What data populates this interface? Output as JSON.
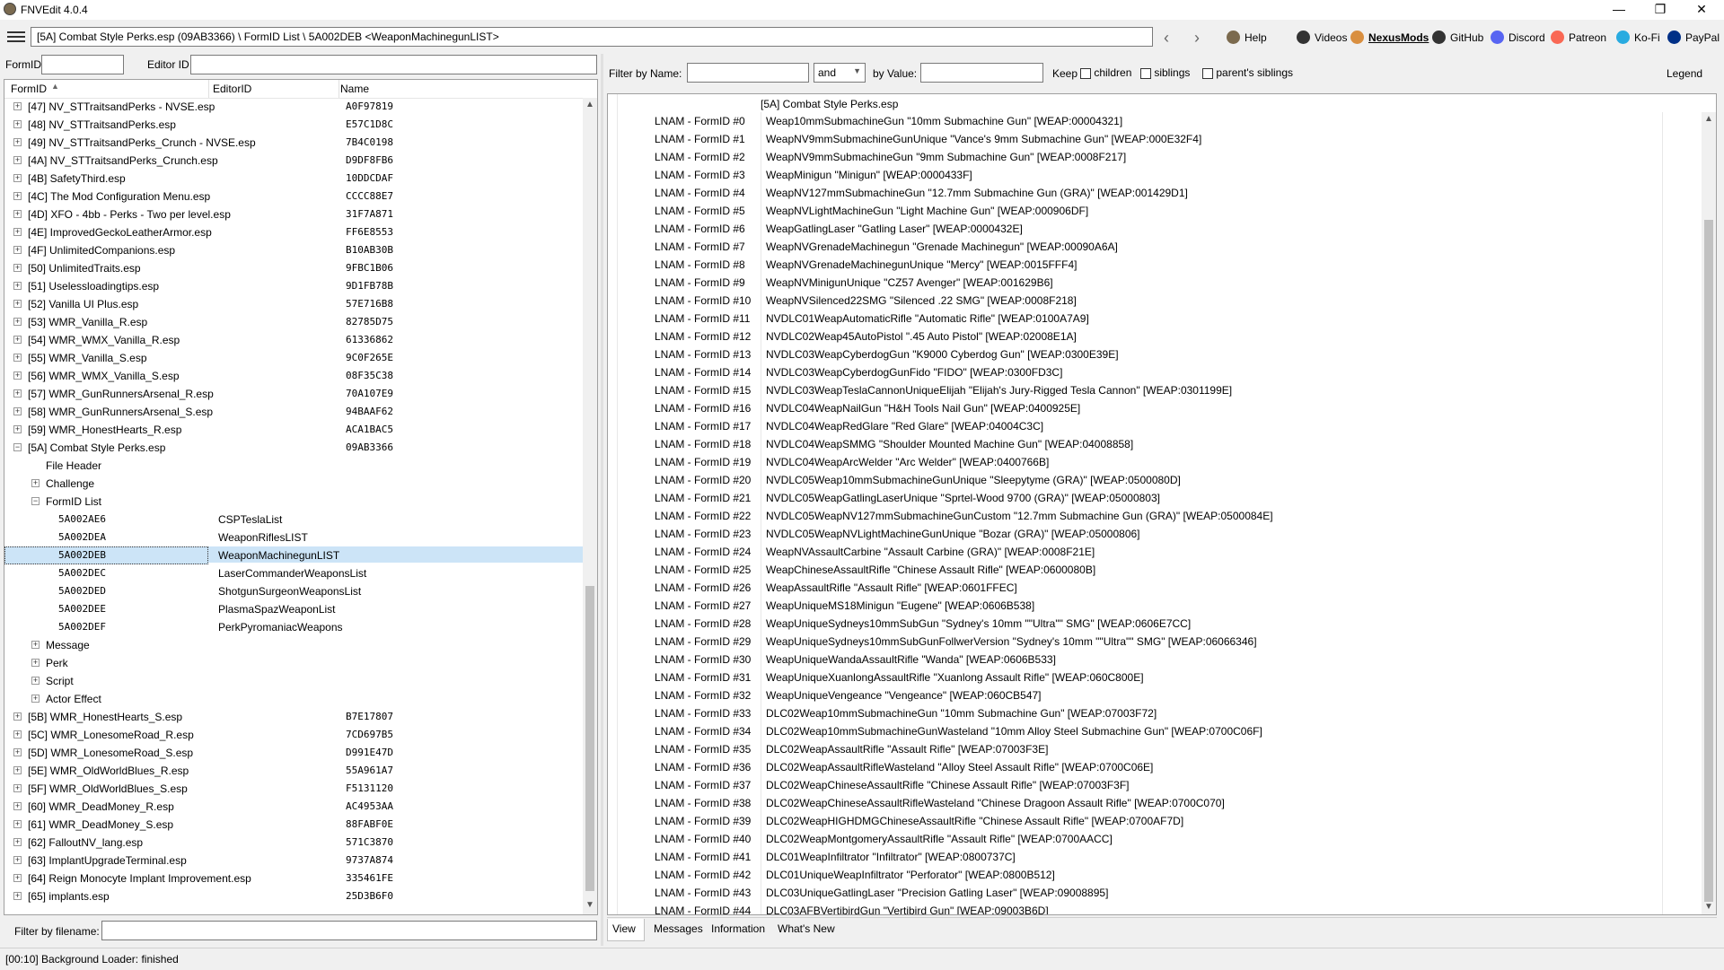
{
  "window": {
    "title": "FNVEdit 4.0.4",
    "minimize": "—",
    "maximize": "❐",
    "close": "✕"
  },
  "toolbar": {
    "path": "[5A] Combat Style Perks.esp (09AB3366) \\ FormID List \\ 5A002DEB <WeaponMachinegunLIST>",
    "links": [
      {
        "label": "Help",
        "icon": "book-icon",
        "color": "#7b6a4e"
      },
      {
        "label": "Videos",
        "icon": "video-icon",
        "color": "#333333"
      },
      {
        "label": "NexusMods",
        "icon": "nexusmods-icon",
        "color": "#d98f40"
      },
      {
        "label": "GitHub",
        "icon": "github-icon",
        "color": "#333333"
      },
      {
        "label": "Discord",
        "icon": "discord-icon",
        "color": "#5865f2"
      },
      {
        "label": "Patreon",
        "icon": "patreon-icon",
        "color": "#f96854"
      },
      {
        "label": "Ko-Fi",
        "icon": "kofi-icon",
        "color": "#29abe0"
      },
      {
        "label": "PayPal",
        "icon": "paypal-icon",
        "color": "#003087"
      }
    ]
  },
  "left_filter": {
    "formid_label": "FormID",
    "editorid_label": "Editor ID",
    "formid_value": "",
    "editorid_value": ""
  },
  "tree": {
    "columns": [
      "FormID",
      "EditorID",
      "Name"
    ],
    "rows": [
      {
        "level": 0,
        "exp": "+",
        "name": "[47] NV_STTraitsandPerks - NVSE.esp",
        "fid": "A0F97819",
        "eid": ""
      },
      {
        "level": 0,
        "exp": "+",
        "name": "[48] NV_STTraitsandPerks.esp",
        "fid": "E57C1D8C",
        "eid": ""
      },
      {
        "level": 0,
        "exp": "+",
        "name": "[49] NV_STTraitsandPerks_Crunch - NVSE.esp",
        "fid": "7B4C0198",
        "eid": ""
      },
      {
        "level": 0,
        "exp": "+",
        "name": "[4A] NV_STTraitsandPerks_Crunch.esp",
        "fid": "D9DF8FB6",
        "eid": ""
      },
      {
        "level": 0,
        "exp": "+",
        "name": "[4B] SafetyThird.esp",
        "fid": "10DDCDAF",
        "eid": ""
      },
      {
        "level": 0,
        "exp": "+",
        "name": "[4C] The Mod Configuration Menu.esp",
        "fid": "CCCC88E7",
        "eid": ""
      },
      {
        "level": 0,
        "exp": "+",
        "name": "[4D] XFO - 4bb - Perks - Two per level.esp",
        "fid": "31F7A871",
        "eid": ""
      },
      {
        "level": 0,
        "exp": "+",
        "name": "[4E] ImprovedGeckoLeatherArmor.esp",
        "fid": "FF6E8553",
        "eid": ""
      },
      {
        "level": 0,
        "exp": "+",
        "name": "[4F] UnlimitedCompanions.esp",
        "fid": "B10AB30B",
        "eid": ""
      },
      {
        "level": 0,
        "exp": "+",
        "name": "[50] UnlimitedTraits.esp",
        "fid": "9FBC1B06",
        "eid": ""
      },
      {
        "level": 0,
        "exp": "+",
        "name": "[51] Uselessloadingtips.esp",
        "fid": "9D1FB78B",
        "eid": ""
      },
      {
        "level": 0,
        "exp": "+",
        "name": "[52] Vanilla UI Plus.esp",
        "fid": "57E716B8",
        "eid": ""
      },
      {
        "level": 0,
        "exp": "+",
        "name": "[53] WMR_Vanilla_R.esp",
        "fid": "82785D75",
        "eid": ""
      },
      {
        "level": 0,
        "exp": "+",
        "name": "[54] WMR_WMX_Vanilla_R.esp",
        "fid": "61336862",
        "eid": ""
      },
      {
        "level": 0,
        "exp": "+",
        "name": "[55] WMR_Vanilla_S.esp",
        "fid": "9C0F265E",
        "eid": ""
      },
      {
        "level": 0,
        "exp": "+",
        "name": "[56] WMR_WMX_Vanilla_S.esp",
        "fid": "08F35C38",
        "eid": ""
      },
      {
        "level": 0,
        "exp": "+",
        "name": "[57] WMR_GunRunnersArsenal_R.esp",
        "fid": "70A107E9",
        "eid": ""
      },
      {
        "level": 0,
        "exp": "+",
        "name": "[58] WMR_GunRunnersArsenal_S.esp",
        "fid": "94BAAF62",
        "eid": ""
      },
      {
        "level": 0,
        "exp": "+",
        "name": "[59] WMR_HonestHearts_R.esp",
        "fid": "ACA1BAC5",
        "eid": ""
      },
      {
        "level": 0,
        "exp": "−",
        "name": "[5A] Combat Style Perks.esp",
        "fid": "09AB3366",
        "eid": ""
      },
      {
        "level": 1,
        "exp": "",
        "name": "File Header",
        "fid": "",
        "eid": ""
      },
      {
        "level": 1,
        "exp": "+",
        "name": "Challenge",
        "fid": "",
        "eid": ""
      },
      {
        "level": 1,
        "exp": "−",
        "name": "FormID List",
        "fid": "",
        "eid": ""
      },
      {
        "level": 2,
        "exp": "",
        "name": "5A002AE6",
        "fid": "",
        "eid": "CSPTeslaList"
      },
      {
        "level": 2,
        "exp": "",
        "name": "5A002DEA",
        "fid": "",
        "eid": "WeaponRiflesLIST"
      },
      {
        "level": 2,
        "exp": "",
        "name": "5A002DEB",
        "fid": "",
        "eid": "WeaponMachinegunLIST",
        "selected": true
      },
      {
        "level": 2,
        "exp": "",
        "name": "5A002DEC",
        "fid": "",
        "eid": "LaserCommanderWeaponsList"
      },
      {
        "level": 2,
        "exp": "",
        "name": "5A002DED",
        "fid": "",
        "eid": "ShotgunSurgeonWeaponsList"
      },
      {
        "level": 2,
        "exp": "",
        "name": "5A002DEE",
        "fid": "",
        "eid": "PlasmaSpazWeaponList"
      },
      {
        "level": 2,
        "exp": "",
        "name": "5A002DEF",
        "fid": "",
        "eid": "PerkPyromaniacWeapons"
      },
      {
        "level": 1,
        "exp": "+",
        "name": "Message",
        "fid": "",
        "eid": ""
      },
      {
        "level": 1,
        "exp": "+",
        "name": "Perk",
        "fid": "",
        "eid": ""
      },
      {
        "level": 1,
        "exp": "+",
        "name": "Script",
        "fid": "",
        "eid": ""
      },
      {
        "level": 1,
        "exp": "+",
        "name": "Actor Effect",
        "fid": "",
        "eid": ""
      },
      {
        "level": 0,
        "exp": "+",
        "name": "[5B] WMR_HonestHearts_S.esp",
        "fid": "B7E17807",
        "eid": ""
      },
      {
        "level": 0,
        "exp": "+",
        "name": "[5C] WMR_LonesomeRoad_R.esp",
        "fid": "7CD697B5",
        "eid": ""
      },
      {
        "level": 0,
        "exp": "+",
        "name": "[5D] WMR_LonesomeRoad_S.esp",
        "fid": "D991E47D",
        "eid": ""
      },
      {
        "level": 0,
        "exp": "+",
        "name": "[5E] WMR_OldWorldBlues_R.esp",
        "fid": "55A961A7",
        "eid": ""
      },
      {
        "level": 0,
        "exp": "+",
        "name": "[5F] WMR_OldWorldBlues_S.esp",
        "fid": "F5131120",
        "eid": ""
      },
      {
        "level": 0,
        "exp": "+",
        "name": "[60] WMR_DeadMoney_R.esp",
        "fid": "AC4953AA",
        "eid": ""
      },
      {
        "level": 0,
        "exp": "+",
        "name": "[61] WMR_DeadMoney_S.esp",
        "fid": "88FABF0E",
        "eid": ""
      },
      {
        "level": 0,
        "exp": "+",
        "name": "[62] FalloutNV_lang.esp",
        "fid": "571C3870",
        "eid": ""
      },
      {
        "level": 0,
        "exp": "+",
        "name": "[63] ImplantUpgradeTerminal.esp",
        "fid": "9737A874",
        "eid": ""
      },
      {
        "level": 0,
        "exp": "+",
        "name": "[64] Reign Monocyte Implant Improvement.esp",
        "fid": "335461FE",
        "eid": ""
      },
      {
        "level": 0,
        "exp": "+",
        "name": "[65] implants.esp",
        "fid": "25D3B6F0",
        "eid": ""
      }
    ]
  },
  "filename_filter": {
    "label": "Filter by filename:",
    "value": ""
  },
  "right_filter": {
    "name_label": "Filter by Name:",
    "and_value": "and",
    "value_label": "by Value:",
    "keep_label": "Keep",
    "children_label": "children",
    "siblings_label": "siblings",
    "parents_siblings_label": "parent's siblings",
    "legend_label": "Legend"
  },
  "view": {
    "header": "[5A] Combat Style Perks.esp",
    "rows": [
      {
        "label": "LNAM - FormID #0",
        "value": "Weap10mmSubmachineGun \"10mm Submachine Gun\" [WEAP:00004321]"
      },
      {
        "label": "LNAM - FormID #1",
        "value": "WeapNV9mmSubmachineGunUnique \"Vance's 9mm Submachine Gun\" [WEAP:000E32F4]"
      },
      {
        "label": "LNAM - FormID #2",
        "value": "WeapNV9mmSubmachineGun \"9mm Submachine Gun\" [WEAP:0008F217]"
      },
      {
        "label": "LNAM - FormID #3",
        "value": "WeapMinigun \"Minigun\" [WEAP:0000433F]"
      },
      {
        "label": "LNAM - FormID #4",
        "value": "WeapNV127mmSubmachineGun \"12.7mm Submachine Gun (GRA)\" [WEAP:001429D1]"
      },
      {
        "label": "LNAM - FormID #5",
        "value": "WeapNVLightMachineGun \"Light Machine Gun\" [WEAP:000906DF]"
      },
      {
        "label": "LNAM - FormID #6",
        "value": "WeapGatlingLaser \"Gatling Laser\" [WEAP:0000432E]"
      },
      {
        "label": "LNAM - FormID #7",
        "value": "WeapNVGrenadeMachinegun \"Grenade Machinegun\" [WEAP:00090A6A]"
      },
      {
        "label": "LNAM - FormID #8",
        "value": "WeapNVGrenadeMachinegunUnique \"Mercy\" [WEAP:0015FFF4]"
      },
      {
        "label": "LNAM - FormID #9",
        "value": "WeapNVMinigunUnique \"CZ57 Avenger\" [WEAP:001629B6]"
      },
      {
        "label": "LNAM - FormID #10",
        "value": "WeapNVSilenced22SMG \"Silenced .22 SMG\" [WEAP:0008F218]"
      },
      {
        "label": "LNAM - FormID #11",
        "value": "NVDLC01WeapAutomaticRifle \"Automatic Rifle\" [WEAP:0100A7A9]"
      },
      {
        "label": "LNAM - FormID #12",
        "value": "NVDLC02Weap45AutoPistol \".45 Auto Pistol\" [WEAP:02008E1A]"
      },
      {
        "label": "LNAM - FormID #13",
        "value": "NVDLC03WeapCyberdogGun \"K9000 Cyberdog Gun\" [WEAP:0300E39E]"
      },
      {
        "label": "LNAM - FormID #14",
        "value": "NVDLC03WeapCyberdogGunFido \"FIDO\" [WEAP:0300FD3C]"
      },
      {
        "label": "LNAM - FormID #15",
        "value": "NVDLC03WeapTeslaCannonUniqueElijah \"Elijah's Jury-Rigged Tesla Cannon\" [WEAP:0301199E]"
      },
      {
        "label": "LNAM - FormID #16",
        "value": "NVDLC04WeapNailGun \"H&H Tools Nail Gun\" [WEAP:0400925E]"
      },
      {
        "label": "LNAM - FormID #17",
        "value": "NVDLC04WeapRedGlare \"Red Glare\" [WEAP:04004C3C]"
      },
      {
        "label": "LNAM - FormID #18",
        "value": "NVDLC04WeapSMMG \"Shoulder Mounted Machine Gun\" [WEAP:04008858]"
      },
      {
        "label": "LNAM - FormID #19",
        "value": "NVDLC04WeapArcWelder \"Arc Welder\" [WEAP:0400766B]"
      },
      {
        "label": "LNAM - FormID #20",
        "value": "NVDLC05Weap10mmSubmachineGunUnique \"Sleepytyme (GRA)\" [WEAP:0500080D]"
      },
      {
        "label": "LNAM - FormID #21",
        "value": "NVDLC05WeapGatlingLaserUnique \"Sprtel-Wood 9700 (GRA)\" [WEAP:05000803]"
      },
      {
        "label": "LNAM - FormID #22",
        "value": "NVDLC05WeapNV127mmSubmachineGunCustom \"12.7mm Submachine Gun (GRA)\" [WEAP:0500084E]"
      },
      {
        "label": "LNAM - FormID #23",
        "value": "NVDLC05WeapNVLightMachineGunUnique \"Bozar (GRA)\" [WEAP:05000806]"
      },
      {
        "label": "LNAM - FormID #24",
        "value": "WeapNVAssaultCarbine \"Assault Carbine (GRA)\" [WEAP:0008F21E]"
      },
      {
        "label": "LNAM - FormID #25",
        "value": "WeapChineseAssaultRifle \"Chinese Assault Rifle\" [WEAP:0600080B]"
      },
      {
        "label": "LNAM - FormID #26",
        "value": "WeapAssaultRifle \"Assault Rifle\" [WEAP:0601FFEC]"
      },
      {
        "label": "LNAM - FormID #27",
        "value": "WeapUniqueMS18Minigun \"Eugene\" [WEAP:0606B538]"
      },
      {
        "label": "LNAM - FormID #28",
        "value": "WeapUniqueSydneys10mmSubGun \"Sydney's 10mm \"\"Ultra\"\" SMG\" [WEAP:0606E7CC]"
      },
      {
        "label": "LNAM - FormID #29",
        "value": "WeapUniqueSydneys10mmSubGunFollwerVersion \"Sydney's 10mm \"\"Ultra\"\" SMG\" [WEAP:06066346]"
      },
      {
        "label": "LNAM - FormID #30",
        "value": "WeapUniqueWandaAssaultRifle \"Wanda\" [WEAP:0606B533]"
      },
      {
        "label": "LNAM - FormID #31",
        "value": "WeapUniqueXuanlongAssaultRifle \"Xuanlong Assault Rifle\" [WEAP:060C800E]"
      },
      {
        "label": "LNAM - FormID #32",
        "value": "WeapUniqueVengeance \"Vengeance\" [WEAP:060CB547]"
      },
      {
        "label": "LNAM - FormID #33",
        "value": "DLC02Weap10mmSubmachineGun \"10mm Submachine Gun\" [WEAP:07003F72]"
      },
      {
        "label": "LNAM - FormID #34",
        "value": "DLC02Weap10mmSubmachineGunWasteland \"10mm Alloy Steel Submachine Gun\" [WEAP:0700C06F]"
      },
      {
        "label": "LNAM - FormID #35",
        "value": "DLC02WeapAssaultRifle \"Assault Rifle\" [WEAP:07003F3E]"
      },
      {
        "label": "LNAM - FormID #36",
        "value": "DLC02WeapAssaultRifleWasteland \"Alloy Steel Assault Rifle\" [WEAP:0700C06E]"
      },
      {
        "label": "LNAM - FormID #37",
        "value": "DLC02WeapChineseAssaultRifle \"Chinese Assault Rifle\" [WEAP:07003F3F]"
      },
      {
        "label": "LNAM - FormID #38",
        "value": "DLC02WeapChineseAssaultRifleWasteland \"Chinese Dragoon Assault Rifle\" [WEAP:0700C070]"
      },
      {
        "label": "LNAM - FormID #39",
        "value": "DLC02WeapHIGHDMGChineseAssaultRifle \"Chinese Assault Rifle\" [WEAP:0700AF7D]"
      },
      {
        "label": "LNAM - FormID #40",
        "value": "DLC02WeapMontgomeryAssaultRifle \"Assault Rifle\" [WEAP:0700AACC]"
      },
      {
        "label": "LNAM - FormID #41",
        "value": "DLC01WeapInfiltrator \"Infiltrator\" [WEAP:0800737C]"
      },
      {
        "label": "LNAM - FormID #42",
        "value": "DLC01UniqueWeapInfiltrator \"Perforator\" [WEAP:0800B512]"
      },
      {
        "label": "LNAM - FormID #43",
        "value": "DLC03UniqueGatlingLaser \"Precision Gatling Laser\" [WEAP:09008895]"
      },
      {
        "label": "LNAM - FormID #44",
        "value": "DLC03AFBVertibirdGun \"Vertibird Gun\" [WEAP:09003B6D]"
      }
    ]
  },
  "tabs": [
    "View",
    "Messages",
    "Information",
    "What's New"
  ],
  "status": "[00:10] Background Loader: finished"
}
